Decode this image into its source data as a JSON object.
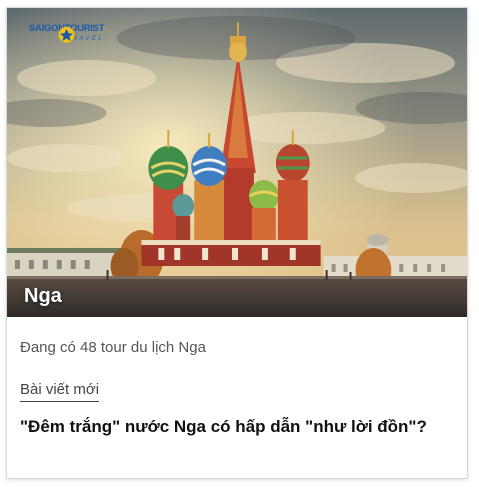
{
  "brand": {
    "name": "SAIGONTOURIST",
    "sub": "TRAVEL",
    "color": "#1d5aa8"
  },
  "card": {
    "destination": "Nga",
    "tour_count_text": "Đang có 48 tour du lịch Nga",
    "tab_label": "Bài viết mới",
    "article_title": "\"Đêm trắng\" nước Nga có hấp dẫn \"như lời đồn\"?"
  },
  "colors": {
    "title_text": "#111111",
    "muted_text": "#555555"
  }
}
